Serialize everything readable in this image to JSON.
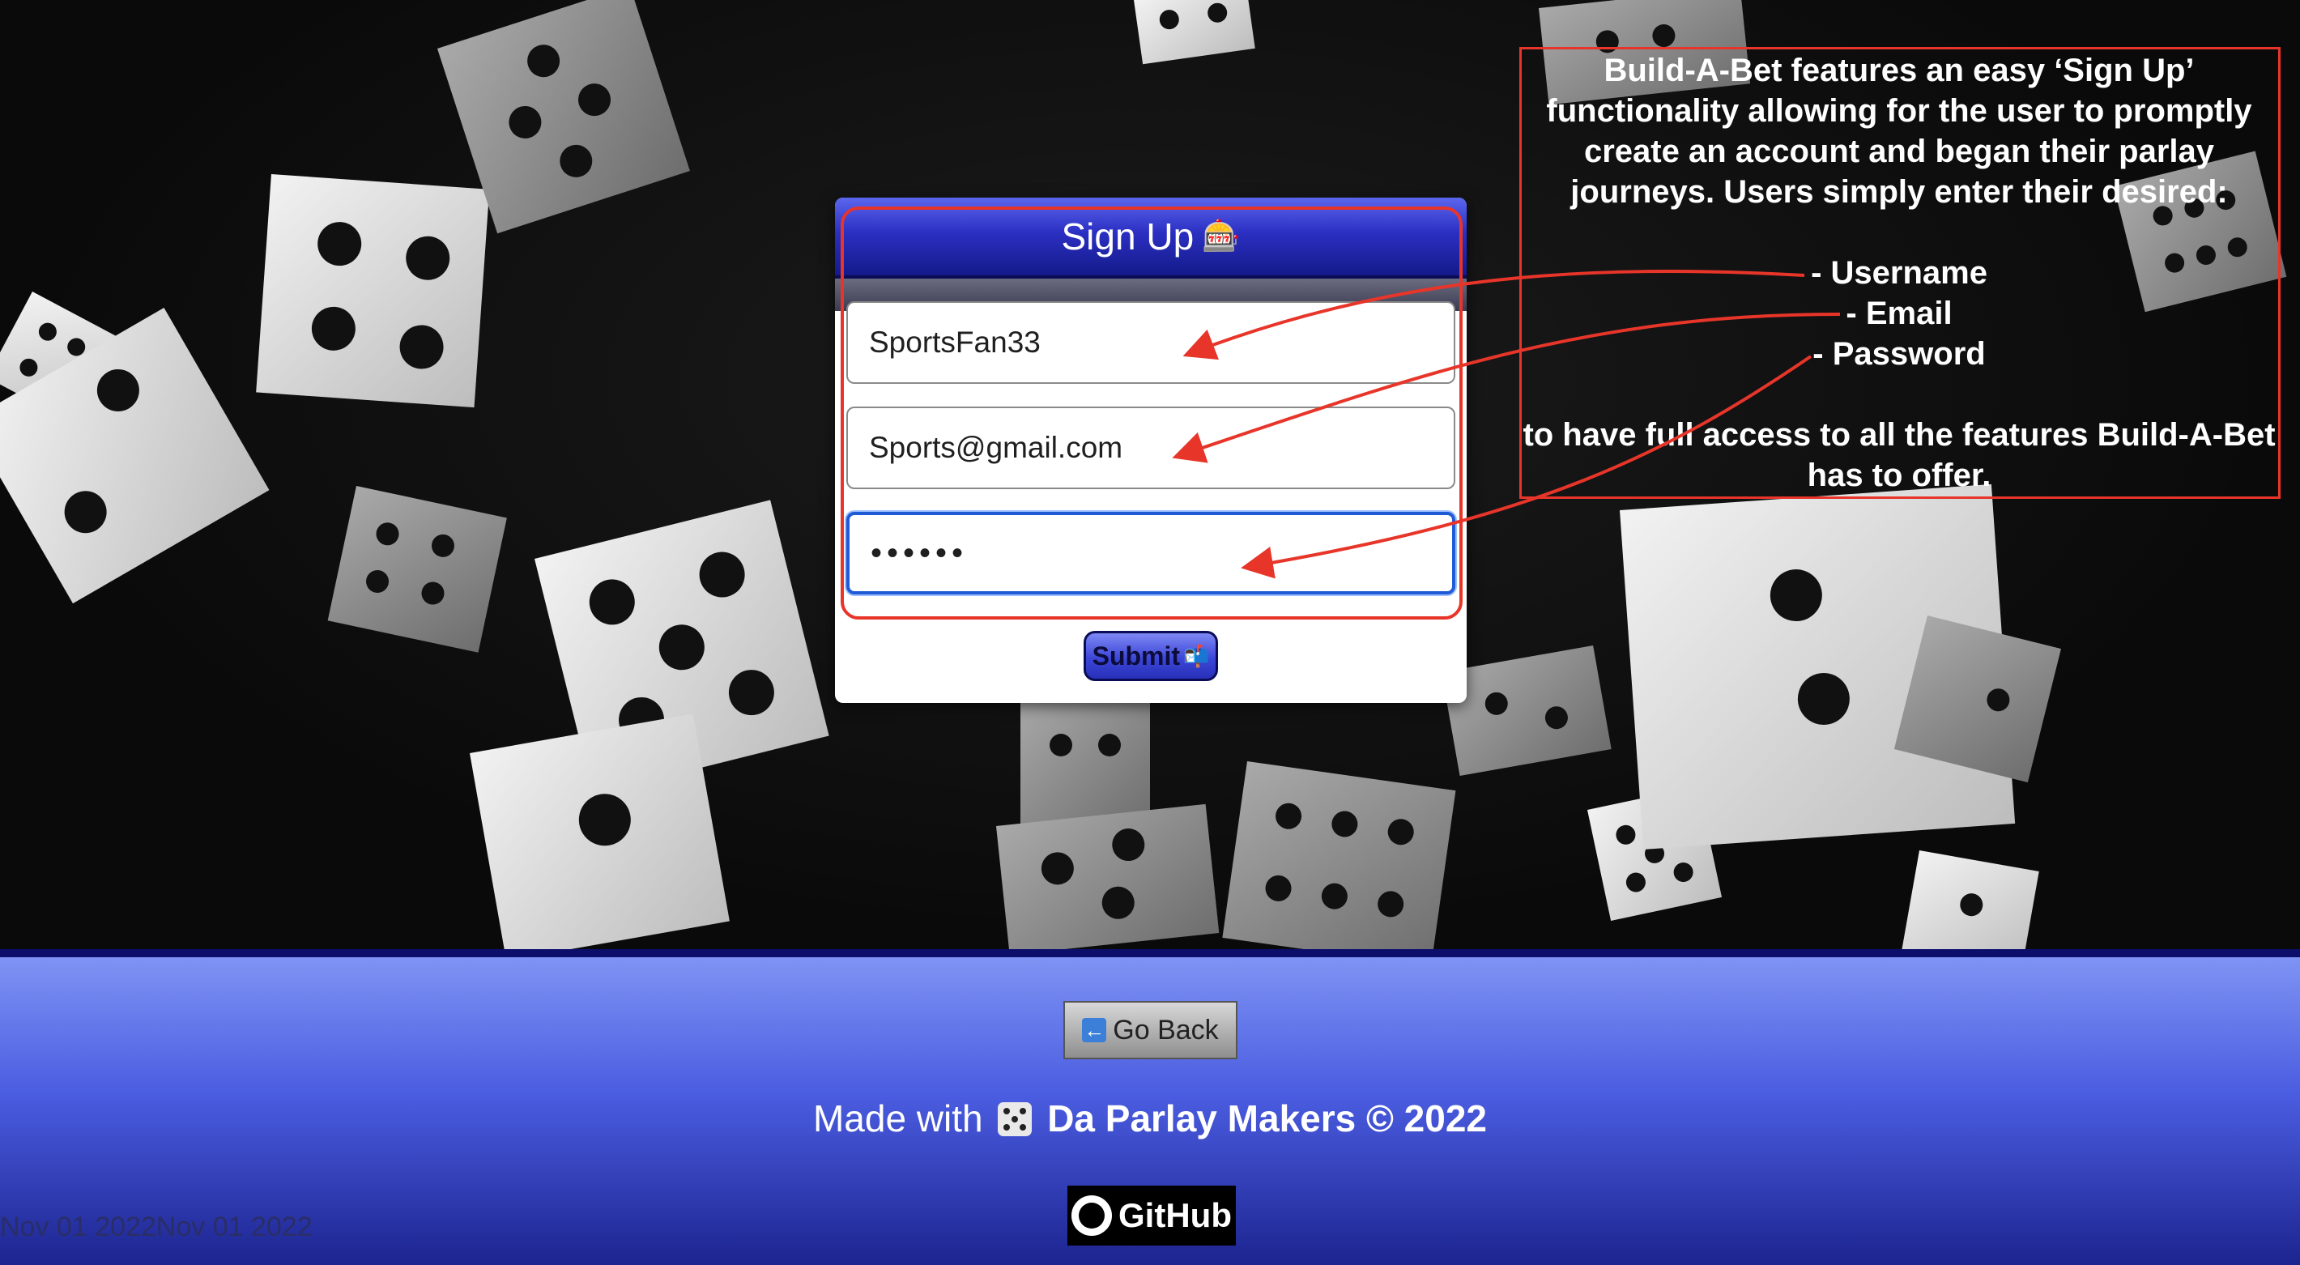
{
  "signup": {
    "title": "Sign Up",
    "title_emoji": "🎰",
    "username_value": "SportsFan33",
    "email_value": "Sports@gmail.com",
    "password_value": "••••••",
    "submit_label": "Submit",
    "submit_emoji": "📬"
  },
  "annotation": {
    "lines": [
      "Build-A-Bet features an easy ‘Sign Up’ functionality allowing for the user to promptly create an account and began their parlay journeys. Users simply enter their desired:"
    ],
    "items": [
      "- Username",
      "- Email",
      "- Password"
    ],
    "closing": "to have full access to all the features Build-A-Bet has to offer.",
    "highlight_color": "#e8352a"
  },
  "footer": {
    "go_back_label": "Go Back",
    "go_back_icon": "left-arrow-icon",
    "made_with": "Made with",
    "brand": "Da Parlay Makers © 2022",
    "github_label": "GitHub",
    "date_stamp": "Nov 01 2022Nov 01 2022"
  },
  "colors": {
    "header_blue": "#2b2fc2",
    "focus_blue": "#1f5bd6",
    "footer_top": "#7f93f4",
    "footer_bottom": "#1c248f"
  }
}
